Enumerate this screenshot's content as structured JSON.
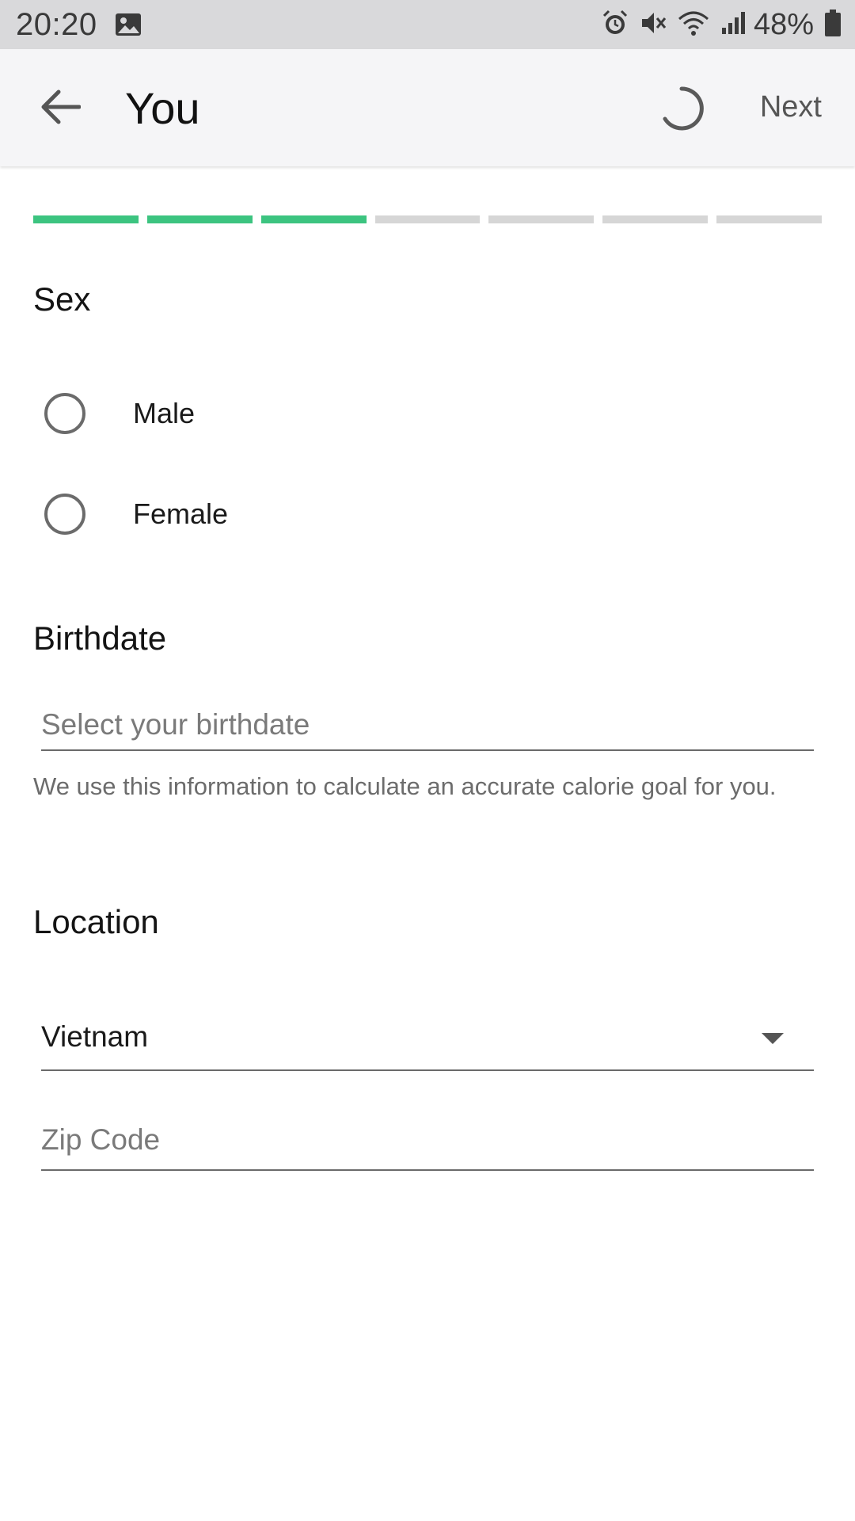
{
  "status_bar": {
    "time": "20:20",
    "battery": "48%",
    "icons": [
      "gallery-icon",
      "alarm-icon",
      "mute-icon",
      "wifi-icon",
      "signal-icon",
      "battery-icon"
    ]
  },
  "app_bar": {
    "title": "You",
    "next_label": "Next"
  },
  "progress": {
    "total_steps": 7,
    "completed_steps": 3,
    "done_color": "#3cc480",
    "pending_color": "#d6d6d6"
  },
  "sex": {
    "title": "Sex",
    "options": [
      {
        "label": "Male",
        "selected": false
      },
      {
        "label": "Female",
        "selected": false
      }
    ]
  },
  "birthdate": {
    "title": "Birthdate",
    "placeholder": "Select your birthdate",
    "helper": "We use this information to calculate an accurate calorie goal for you."
  },
  "location": {
    "title": "Location",
    "country": "Vietnam",
    "zip_placeholder": "Zip Code"
  }
}
